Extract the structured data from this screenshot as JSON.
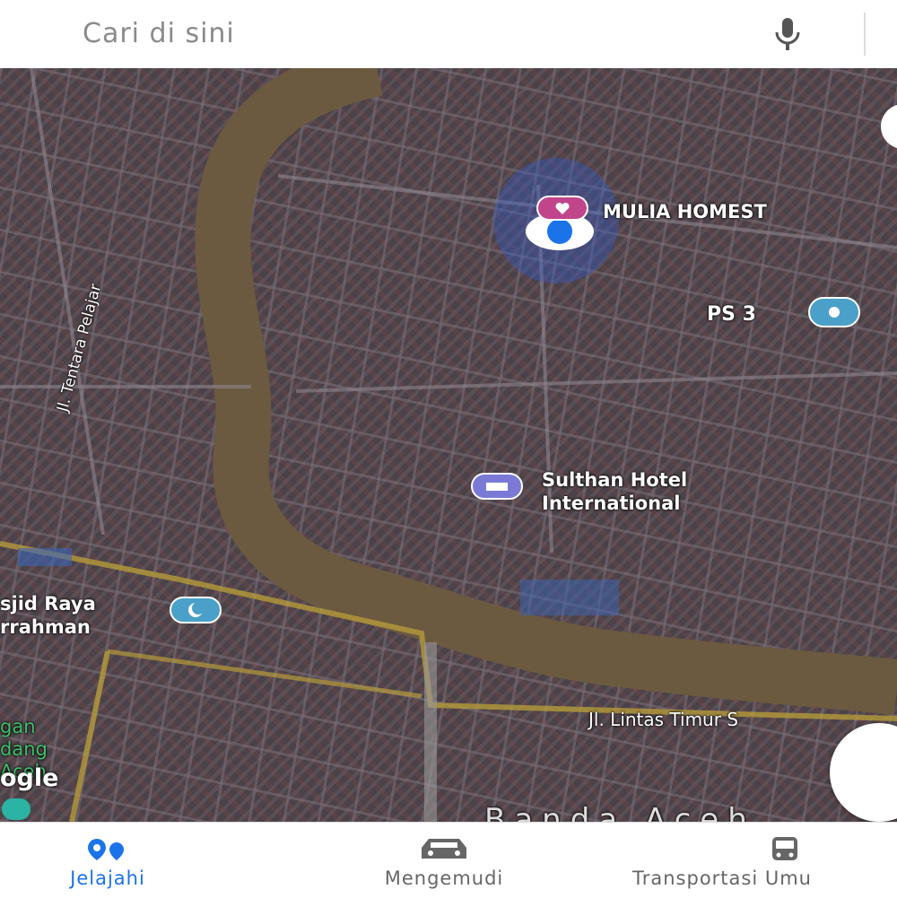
{
  "search": {
    "placeholder": "Cari di sini"
  },
  "map": {
    "places": {
      "mulia": "MULIA HOMEST",
      "ps3": "PS 3",
      "sulthan_line1": "Sulthan Hotel",
      "sulthan_line2": "International",
      "masjid_line1": "sjid Raya",
      "masjid_line2": "rrahman",
      "road_tentara": "Jl. Tentara Pelajar",
      "road_lintas": "Jl. Lintas Timur S",
      "green_line1": "gan",
      "green_line2": "dang",
      "green_line3": "Aceh",
      "city": "Banda Aceh",
      "google": "ogle"
    }
  },
  "nav": {
    "items": [
      {
        "label": "Jelajahi",
        "icon": "explore-pin-icon",
        "active": true
      },
      {
        "label": "Mengemudi",
        "icon": "car-icon",
        "active": false
      },
      {
        "label": "Transportasi Umu",
        "icon": "train-icon",
        "active": false
      }
    ]
  },
  "colors": {
    "accent": "#1a73e8",
    "river": "#6b5a40",
    "road": "#b59a3a"
  }
}
